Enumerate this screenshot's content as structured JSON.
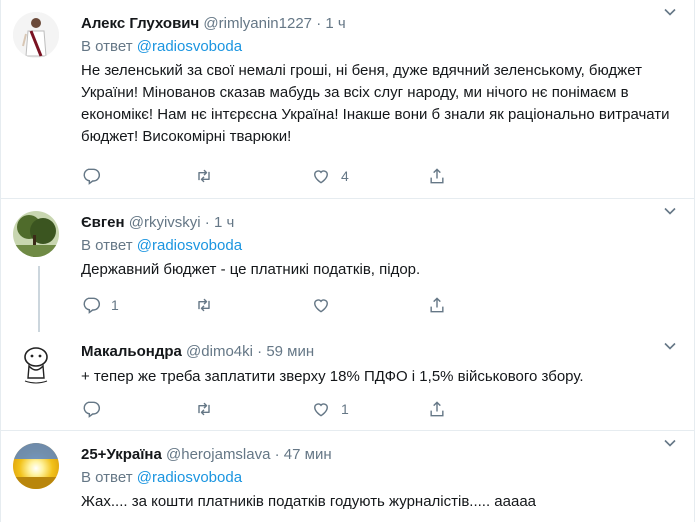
{
  "reply_prefix": "В ответ",
  "tweets": [
    {
      "name": "Алекс Глухович",
      "handle": "@rimlyanin1227",
      "time": "1 ч",
      "reply_to": "@radiosvoboda",
      "text": "Не зеленський за свої немалі гроші, ні беня, дуже вдячний зеленському, бюджет України! Мінованов сказав мабудь за всіх слуг народу, ми нічого нє понімаєм в економікє! Нам нє інтєрєсна Україна! Інакше вони б знали як раціонально витрачати бюджет! Високомірні тварюки!",
      "replies": "",
      "retweets": "",
      "likes": "4"
    },
    {
      "name": "Євген",
      "handle": "@rkyivskyi",
      "time": "1 ч",
      "reply_to": "@radiosvoboda",
      "text": "Державний бюджет - це платникі податків, підор.",
      "replies": "1",
      "retweets": "",
      "likes": ""
    },
    {
      "name": "Макальондра",
      "handle": "@dimo4ki",
      "time": "59 мин",
      "reply_to": "",
      "text": "+ тепер же треба заплатити зверху 18% ПДФО і 1,5% військового збору.",
      "replies": "",
      "retweets": "",
      "likes": "1"
    },
    {
      "name": "25+Україна",
      "handle": "@herojamslava",
      "time": "47 мин",
      "reply_to": "@radiosvoboda",
      "text": "Жах.... за кошти платників податків годують журналістів..... ааааа",
      "replies": "",
      "retweets": "",
      "likes": ""
    }
  ],
  "colors": {
    "accent": "#1b95e0",
    "muted": "#657786",
    "text": "#14171a",
    "border": "#e6ecf0"
  }
}
